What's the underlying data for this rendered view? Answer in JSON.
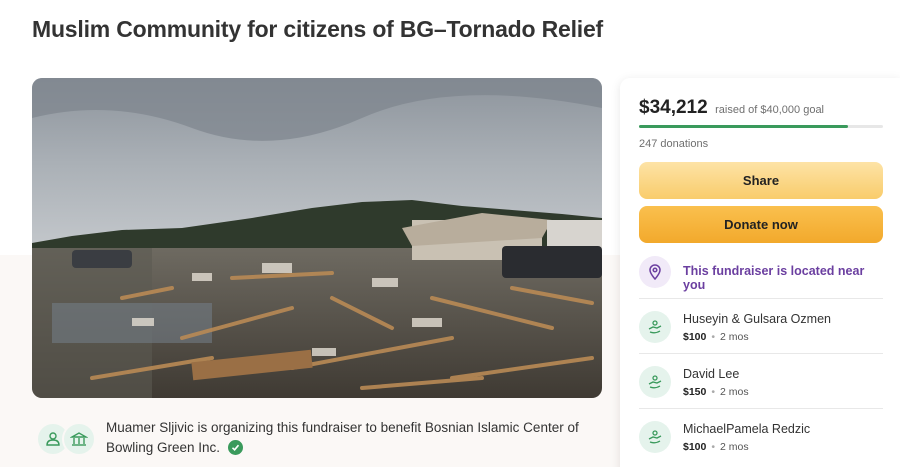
{
  "page": {
    "title": "Muslim Community for citizens of BG–Tornado Relief"
  },
  "hero_image": {
    "icon": "tornado-damage-photo"
  },
  "organizer": {
    "text": "Muamer Sljivic is organizing this fundraiser to benefit Bosnian Islamic Center of Bowling Green Inc.",
    "verified_icon": "check-circle-icon",
    "accent_color": "#3a9a5c"
  },
  "donation_card": {
    "amount_raised": "$34,212",
    "goal_text": "raised of $40,000 goal",
    "progress_fraction": 0.855,
    "donations_count": "247 donations",
    "share_label": "Share",
    "donate_label": "Donate now",
    "location_notice": "This fundraiser is located near you",
    "location_icon": "location-pin-icon",
    "donors": [
      {
        "name": "Huseyin & Gulsara Ozmen",
        "amount": "$100",
        "time": "2 mos"
      },
      {
        "name": "David Lee",
        "amount": "$150",
        "time": "2 mos"
      },
      {
        "name": "MichaelPamela Redzic",
        "amount": "$100",
        "time": "2 mos"
      }
    ]
  },
  "colors": {
    "progress": "#3a9a5c",
    "share_button": "#f9cc6b",
    "donate_button": "#f2a92c",
    "location_text": "#6b3fa0"
  }
}
